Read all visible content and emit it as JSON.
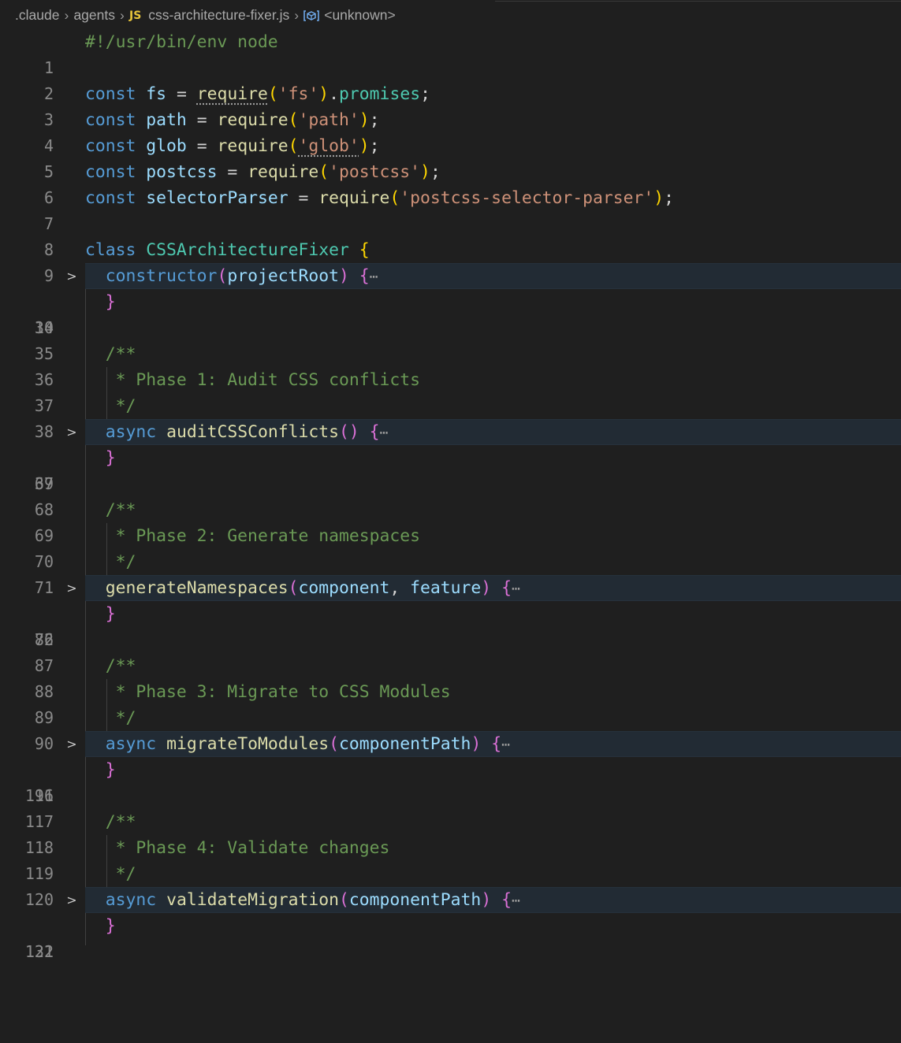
{
  "breadcrumb": {
    "folder1": ".claude",
    "folder2": "agents",
    "file_badge": "JS",
    "file_name": "css-architecture-fixer.js",
    "symbol": "<unknown>"
  },
  "editor": {
    "fold_glyph": ">",
    "ellipsis": "⋯",
    "line_numbers": {
      "l1": "1",
      "l2": "2",
      "l3": "3",
      "l4": "4",
      "l5": "5",
      "l6": "6",
      "l7": "7",
      "l8": "8",
      "l9": "9",
      "l10": "10",
      "l34": "34",
      "l35": "35",
      "l36": "36",
      "l37": "37",
      "l38": "38",
      "l39": "39",
      "l67": "67",
      "l68": "68",
      "l69": "69",
      "l70": "70",
      "l71": "71",
      "l72": "72",
      "l86": "86",
      "l87": "87",
      "l88": "88",
      "l89": "89",
      "l90": "90",
      "l91": "91",
      "l116": "116",
      "l117": "117",
      "l118": "118",
      "l119": "119",
      "l120": "120",
      "l121": "121",
      "l132": "132"
    },
    "tokens": {
      "shebang": "#!/usr/bin/env node",
      "const": "const",
      "class": "class",
      "async": "async",
      "fs": "fs",
      "path": "path",
      "glob": "glob",
      "postcss": "postcss",
      "selectorParser": "selectorParser",
      "require": "require",
      "eq": " = ",
      "str_fs": "'fs'",
      "str_path": "'path'",
      "str_glob": "'glob'",
      "str_postcss": "'postcss'",
      "str_selector": "'postcss-selector-parser'",
      "promises": "promises",
      "class_name": "CSSArchitectureFixer",
      "constructor": "constructor",
      "projectRoot": "projectRoot",
      "auditCSSConflicts": "auditCSSConflicts",
      "generateNamespaces": "generateNamespaces",
      "component": "component",
      "feature": "feature",
      "migrateToModules": "migrateToModules",
      "componentPath": "componentPath",
      "validateMigration": "validateMigration",
      "doc_open": "/**",
      "doc_close": " */",
      "phase1": " * Phase 1: Audit CSS conflicts",
      "phase2": " * Phase 2: Generate namespaces",
      "phase3": " * Phase 3: Migrate to CSS Modules",
      "phase4": " * Phase 4: Validate changes"
    }
  }
}
